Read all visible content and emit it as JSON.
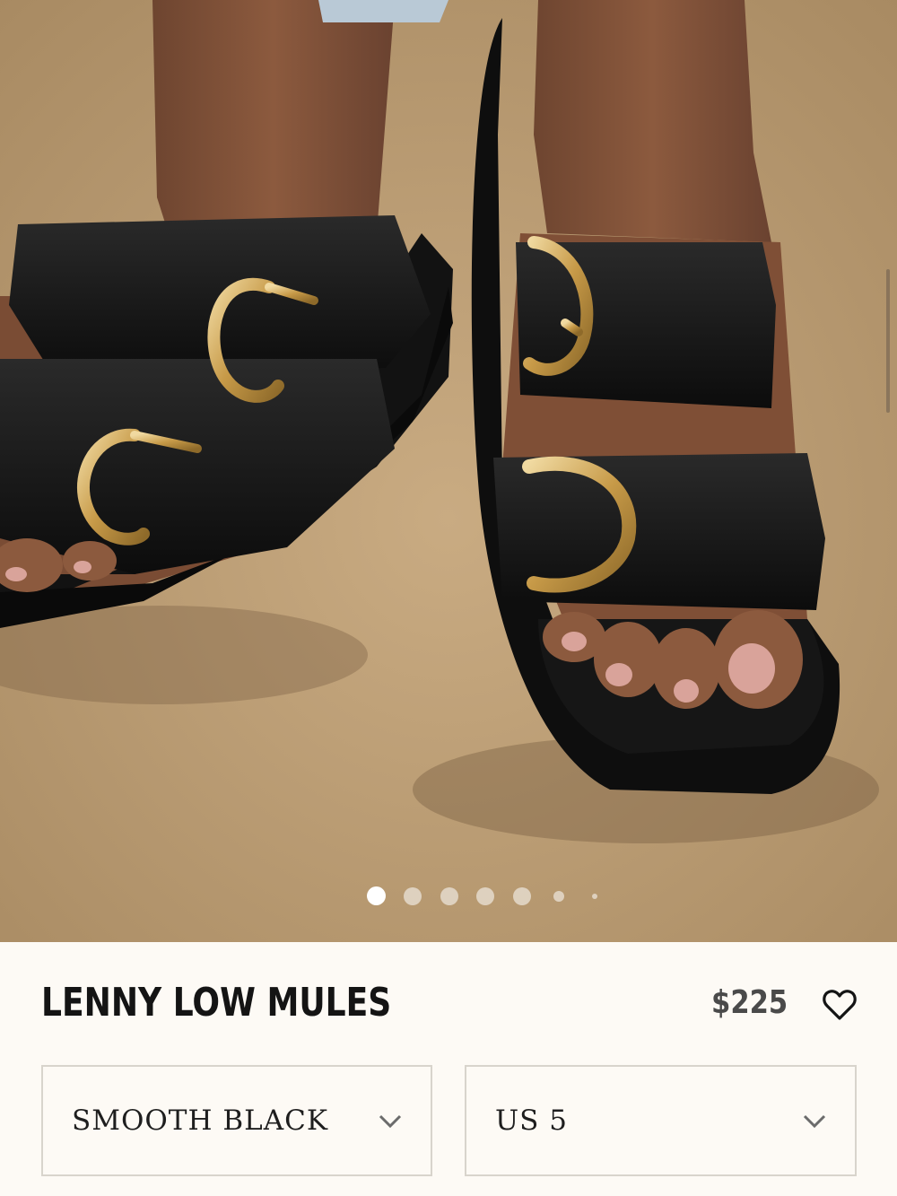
{
  "product": {
    "name": "LENNY LOW MULES",
    "price": "$225",
    "favorite_icon": "heart-outline-icon"
  },
  "gallery": {
    "image_alt_subject": "black leather double-buckle slide sandals with gold buckles",
    "slide_count": 7,
    "active_slide": 1
  },
  "options": {
    "color": {
      "selected": "SMOOTH BLACK",
      "icon": "chevron-down-icon"
    },
    "size": {
      "selected": "US 5",
      "icon": "chevron-down-icon"
    }
  },
  "colors": {
    "background": "#fdfaf5",
    "text": "#141414",
    "price": "#4a4a4a",
    "border": "#d8d4cc",
    "backdrop": "#c3a47a"
  }
}
